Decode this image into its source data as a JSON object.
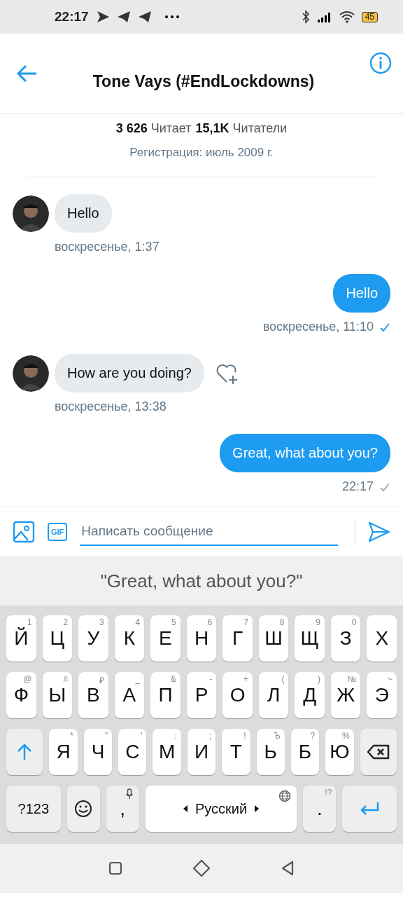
{
  "status_bar": {
    "time": "22:17",
    "battery": "45"
  },
  "header": {
    "title": "Tone Vays (#EndLockdowns)"
  },
  "profile": {
    "following_count": "3 626",
    "following_label": "Читает",
    "followers_count": "15,1K",
    "followers_label": "Читатели",
    "joined": "Регистрация: июль 2009 г."
  },
  "messages": [
    {
      "kind": "incoming",
      "text": "Hello",
      "time": "воскресенье, 1:37",
      "reaction_button": false
    },
    {
      "kind": "outgoing",
      "text": "Hello",
      "time": "воскресенье, 11:10",
      "read": true
    },
    {
      "kind": "incoming",
      "text": "How are you doing?",
      "time": "воскресенье, 13:38",
      "reaction_button": true
    },
    {
      "kind": "outgoing",
      "text": "Great, what about you?",
      "time": "22:17",
      "read": false
    }
  ],
  "composer": {
    "gif_label": "GIF",
    "placeholder": "Написать сообщение"
  },
  "suggestion": "\"Great, what about you?\"",
  "keyboard": {
    "rows": [
      {
        "keys": [
          {
            "kind": "letter",
            "label": "Й",
            "hint": "1"
          },
          {
            "kind": "letter",
            "label": "Ц",
            "hint": "2"
          },
          {
            "kind": "letter",
            "label": "У",
            "hint": "3"
          },
          {
            "kind": "letter",
            "label": "К",
            "hint": "4"
          },
          {
            "kind": "letter",
            "label": "Е",
            "hint": "5"
          },
          {
            "kind": "letter",
            "label": "Н",
            "hint": "6"
          },
          {
            "kind": "letter",
            "label": "Г",
            "hint": "7"
          },
          {
            "kind": "letter",
            "label": "Ш",
            "hint": "8"
          },
          {
            "kind": "letter",
            "label": "Щ",
            "hint": "9"
          },
          {
            "kind": "letter",
            "label": "З",
            "hint": "0"
          },
          {
            "kind": "letter",
            "label": "Х"
          }
        ]
      },
      {
        "keys": [
          {
            "kind": "letter",
            "label": "Ф",
            "hint": "@"
          },
          {
            "kind": "letter",
            "label": "Ы",
            "hint": "#"
          },
          {
            "kind": "letter",
            "label": "В",
            "hint": "₽"
          },
          {
            "kind": "letter",
            "label": "А",
            "hint": "_"
          },
          {
            "kind": "letter",
            "label": "П",
            "hint": "&"
          },
          {
            "kind": "letter",
            "label": "Р",
            "hint": "-"
          },
          {
            "kind": "letter",
            "label": "О",
            "hint": "+"
          },
          {
            "kind": "letter",
            "label": "Л",
            "hint": "("
          },
          {
            "kind": "letter",
            "label": "Д",
            "hint": ")"
          },
          {
            "kind": "letter",
            "label": "Ж",
            "hint": "№"
          },
          {
            "kind": "letter",
            "label": "Э",
            "hint": "~"
          }
        ]
      },
      {
        "keys": [
          {
            "kind": "shift"
          },
          {
            "kind": "letter",
            "label": "Я",
            "hint": "*"
          },
          {
            "kind": "letter",
            "label": "Ч",
            "hint": "\""
          },
          {
            "kind": "letter",
            "label": "С",
            "hint": "'"
          },
          {
            "kind": "letter",
            "label": "М",
            "hint": ":"
          },
          {
            "kind": "letter",
            "label": "И",
            "hint": ";"
          },
          {
            "kind": "letter",
            "label": "Т",
            "hint": "!"
          },
          {
            "kind": "letter",
            "label": "Ь",
            "hint": "Ъ"
          },
          {
            "kind": "letter",
            "label": "Б",
            "hint": "?"
          },
          {
            "kind": "letter",
            "label": "Ю",
            "hint": "%"
          },
          {
            "kind": "backspace"
          }
        ]
      },
      {
        "keys": [
          {
            "kind": "symbols",
            "label": "?123"
          },
          {
            "kind": "emoji"
          },
          {
            "kind": "comma",
            "label": ","
          },
          {
            "kind": "space",
            "label": "Русский"
          },
          {
            "kind": "period",
            "label": ".",
            "hint": "!?"
          },
          {
            "kind": "enter"
          }
        ]
      }
    ]
  }
}
